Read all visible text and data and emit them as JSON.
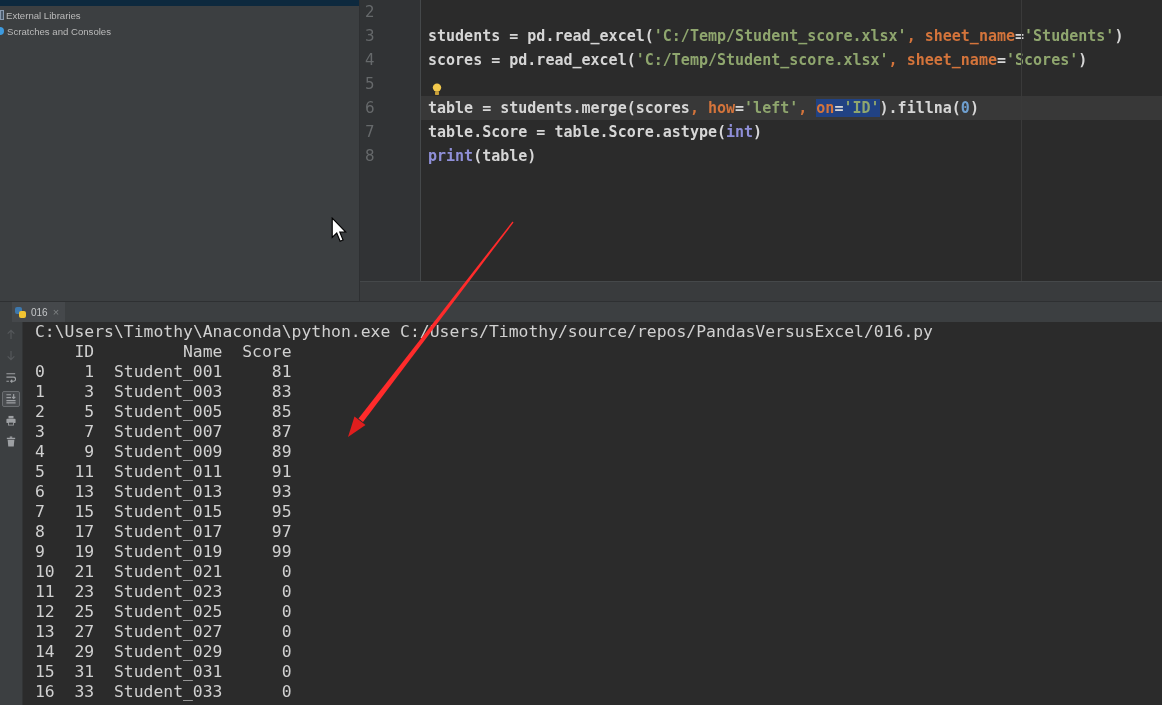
{
  "project_tree": {
    "items": [
      {
        "label": "External Libraries",
        "kind": "library"
      },
      {
        "label": "Scratches and Consoles",
        "kind": "scratches"
      }
    ]
  },
  "editor": {
    "lines": [
      {
        "number": "2",
        "current": false
      },
      {
        "number": "3",
        "current": false,
        "tokens": [
          {
            "text": "students = pd.read_excel(",
            "kind": "plain",
            "selected": false
          },
          {
            "text": "'C:/Temp/Student_score.xlsx'",
            "kind": "string",
            "selected": false
          },
          {
            "text": ", ",
            "kind": "keyword",
            "selected": false
          },
          {
            "text": "sheet_name",
            "kind": "keyword",
            "selected": false
          },
          {
            "text": "=",
            "kind": "plain",
            "selected": false
          },
          {
            "text": "'Students'",
            "kind": "string",
            "selected": false
          },
          {
            "text": ")",
            "kind": "plain",
            "selected": false
          }
        ]
      },
      {
        "number": "4",
        "current": false,
        "tokens": [
          {
            "text": "scores = pd.read_excel(",
            "kind": "plain",
            "selected": false
          },
          {
            "text": "'C:/Temp/Student_score.xlsx'",
            "kind": "string",
            "selected": false
          },
          {
            "text": ", ",
            "kind": "keyword",
            "selected": false
          },
          {
            "text": "sheet_name",
            "kind": "keyword",
            "selected": false
          },
          {
            "text": "=",
            "kind": "plain",
            "selected": false
          },
          {
            "text": "'Scores'",
            "kind": "string",
            "selected": false
          },
          {
            "text": ")",
            "kind": "plain",
            "selected": false
          }
        ]
      },
      {
        "number": "5",
        "current": false,
        "bulb": true
      },
      {
        "number": "6",
        "current": true,
        "tokens": [
          {
            "text": "table = students.merge(scores",
            "kind": "plain",
            "selected": false
          },
          {
            "text": ", ",
            "kind": "keyword",
            "selected": false
          },
          {
            "text": "how",
            "kind": "keyword",
            "selected": false
          },
          {
            "text": "=",
            "kind": "plain",
            "selected": false
          },
          {
            "text": "'left'",
            "kind": "string",
            "selected": false
          },
          {
            "text": ", ",
            "kind": "keyword",
            "selected": false
          },
          {
            "text": "on",
            "kind": "keyword",
            "selected": true
          },
          {
            "text": "=",
            "kind": "plain",
            "selected": true
          },
          {
            "text": "'ID'",
            "kind": "string",
            "selected": true
          },
          {
            "text": ").fillna(",
            "kind": "plain",
            "selected": false
          },
          {
            "text": "0",
            "kind": "number",
            "selected": false
          },
          {
            "text": ")",
            "kind": "plain",
            "selected": false
          }
        ]
      },
      {
        "number": "7",
        "current": false,
        "tokens": [
          {
            "text": "table.Score = table.Score.astype(",
            "kind": "plain",
            "selected": false
          },
          {
            "text": "int",
            "kind": "builtin",
            "selected": false
          },
          {
            "text": ")",
            "kind": "plain",
            "selected": false
          }
        ]
      },
      {
        "number": "8",
        "current": false,
        "tokens": [
          {
            "text": "print",
            "kind": "builtin",
            "selected": false
          },
          {
            "text": "(table)",
            "kind": "plain",
            "selected": false
          }
        ]
      }
    ]
  },
  "run_panel": {
    "tabs": [
      {
        "label": "016",
        "selected": true,
        "close": "×"
      }
    ],
    "toolbar": [
      {
        "kind": "up",
        "disabled": true,
        "on": false
      },
      {
        "kind": "down",
        "disabled": true,
        "on": false
      },
      {
        "kind": "wrap",
        "disabled": false,
        "on": false
      },
      {
        "kind": "scroll_end",
        "disabled": false,
        "on": true
      },
      {
        "kind": "print",
        "disabled": false,
        "on": false
      },
      {
        "kind": "trash",
        "disabled": false,
        "on": false
      }
    ],
    "console": {
      "command": "C:\\Users\\Timothy\\Anaconda\\python.exe C:/Users/Timothy/source/repos/PandasVersusExcel/016.py",
      "columns": [
        "ID",
        "Name",
        "Score"
      ],
      "rows": [
        {
          "index": "0",
          "cells": [
            "1",
            "Student_001",
            "81"
          ]
        },
        {
          "index": "1",
          "cells": [
            "3",
            "Student_003",
            "83"
          ]
        },
        {
          "index": "2",
          "cells": [
            "5",
            "Student_005",
            "85"
          ]
        },
        {
          "index": "3",
          "cells": [
            "7",
            "Student_007",
            "87"
          ]
        },
        {
          "index": "4",
          "cells": [
            "9",
            "Student_009",
            "89"
          ]
        },
        {
          "index": "5",
          "cells": [
            "11",
            "Student_011",
            "91"
          ]
        },
        {
          "index": "6",
          "cells": [
            "13",
            "Student_013",
            "93"
          ]
        },
        {
          "index": "7",
          "cells": [
            "15",
            "Student_015",
            "95"
          ]
        },
        {
          "index": "8",
          "cells": [
            "17",
            "Student_017",
            "97"
          ]
        },
        {
          "index": "9",
          "cells": [
            "19",
            "Student_019",
            "99"
          ]
        },
        {
          "index": "10",
          "cells": [
            "21",
            "Student_021",
            "0"
          ]
        },
        {
          "index": "11",
          "cells": [
            "23",
            "Student_023",
            "0"
          ]
        },
        {
          "index": "12",
          "cells": [
            "25",
            "Student_025",
            "0"
          ]
        },
        {
          "index": "13",
          "cells": [
            "27",
            "Student_027",
            "0"
          ]
        },
        {
          "index": "14",
          "cells": [
            "29",
            "Student_029",
            "0"
          ]
        },
        {
          "index": "15",
          "cells": [
            "31",
            "Student_031",
            "0"
          ]
        },
        {
          "index": "16",
          "cells": [
            "33",
            "Student_033",
            "0"
          ]
        }
      ]
    }
  }
}
